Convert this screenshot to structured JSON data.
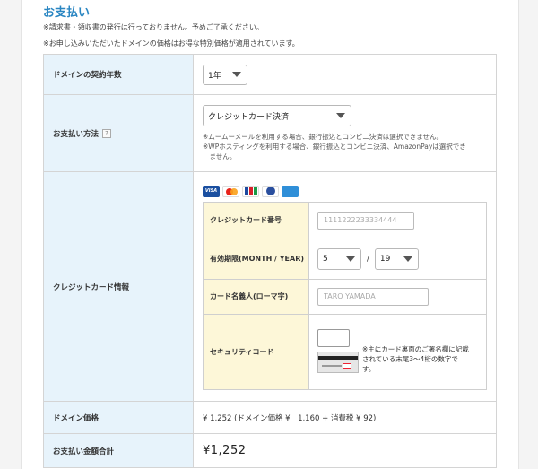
{
  "section_title": "お支払い",
  "notes": [
    "※請求書・領収書の発行は行っておりません。予めご了承ください。",
    "※お申し込みいただいたドメインの価格はお得な特別価格が適用されています。"
  ],
  "contract": {
    "label": "ドメインの契約年数",
    "value": "1年"
  },
  "payment": {
    "label": "お支払い方法",
    "help_icon_text": "?",
    "value": "クレジットカード決済",
    "note_lines": [
      "※ムームーメールを利用する場合、銀行振込とコンビニ決済は選択できません。",
      "※WPホスティングを利用する場合、銀行振込とコンビニ決済、AmazonPayは選択でき",
      "　ません。"
    ]
  },
  "card": {
    "label": "クレジットカード情報",
    "brand_icons": [
      "visa-icon",
      "mastercard-icon",
      "jcb-icon",
      "diners-icon",
      "amex-icon"
    ],
    "brand_visa_text": "VISA",
    "number_label": "クレジットカード番号",
    "number_placeholder": "1111222233334444",
    "expiry_label": "有効期限(MONTH / YEAR)",
    "expiry_month": "5",
    "expiry_separator": "/",
    "expiry_year": "19",
    "name_label": "カード名義人(ローマ字)",
    "name_placeholder": "TARO YAMADA",
    "cvv_label": "セキュリティコード",
    "cvv_note": "※主にカード裏面のご署名欄に記載されている末尾3〜4桁の数字です。"
  },
  "domain_price": {
    "label": "ドメイン価格",
    "value": "¥ 1,252 (ドメイン価格 ¥　1,160 + 消費税 ¥ 92)"
  },
  "total": {
    "label": "お支払い金額合計",
    "value": "¥1,252"
  },
  "colors": {
    "title": "#2a86c2",
    "label_bg": "#e7f3fb",
    "inner_label_bg": "#fdf7d8"
  }
}
